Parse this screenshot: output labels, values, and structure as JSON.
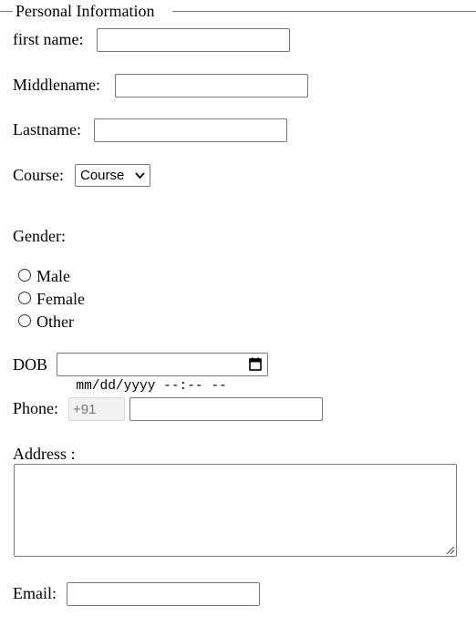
{
  "fieldset": {
    "legend": "Personal Information"
  },
  "form": {
    "first_name_label": "first name:",
    "first_name_value": "",
    "middle_name_label": "Middlename:",
    "middle_name_value": "",
    "last_name_label": "Lastname:",
    "last_name_value": "",
    "course_label": "Course:",
    "course_selected": "Course",
    "gender_label": "Gender:",
    "gender_options": [
      "Male",
      "Female",
      "Other"
    ],
    "dob_label": "DOB",
    "dob_placeholder": "mm/dd/yyyy --:-- --",
    "phone_label": "Phone:",
    "phone_code": "+91",
    "phone_value": "",
    "address_label": "Address :",
    "address_value": "",
    "email_label": "Email:",
    "email_value": ""
  },
  "icons": {
    "course_dropdown": "chevron-down-icon",
    "dob_picker": "calendar-icon",
    "address_resize": "resize-grip-icon"
  },
  "colors": {
    "border": "#767676",
    "disabled_bg": "#f2f2f2",
    "disabled_text": "#8c8c8c"
  }
}
